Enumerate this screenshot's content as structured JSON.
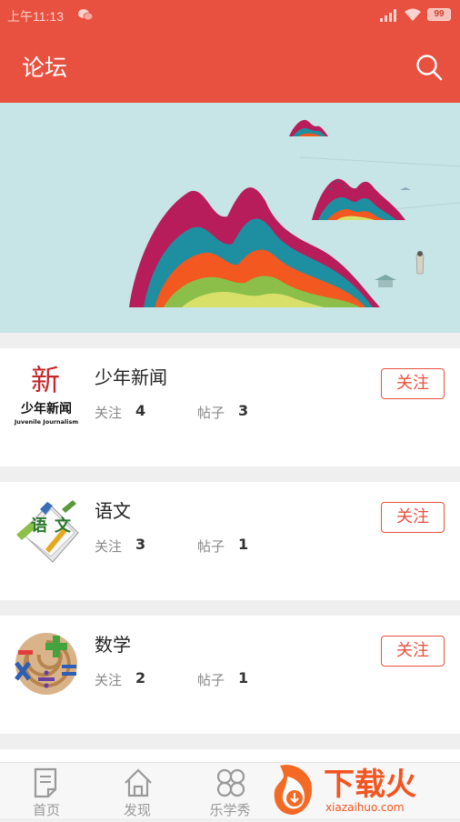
{
  "status_bar": {
    "time": "上午11:13",
    "battery": "99"
  },
  "header": {
    "title": "论坛"
  },
  "forums": [
    {
      "name": "少年新闻",
      "follow_label": "关注",
      "follow_count": "4",
      "posts_label": "帖子",
      "posts_count": "3",
      "follow_button": "关注",
      "logo_text": "少年新闻",
      "logo_subtext": "Juvenile Journalism",
      "logo_seal": "新"
    },
    {
      "name": "语文",
      "follow_label": "关注",
      "follow_count": "3",
      "posts_label": "帖子",
      "posts_count": "1",
      "follow_button": "关注",
      "logo_chars": [
        "语",
        "文"
      ]
    },
    {
      "name": "数学",
      "follow_label": "关注",
      "follow_count": "2",
      "posts_label": "帖子",
      "posts_count": "1",
      "follow_button": "关注"
    }
  ],
  "bottom_nav": [
    {
      "label": "首页",
      "icon": "document-icon"
    },
    {
      "label": "发现",
      "icon": "home-icon"
    },
    {
      "label": "乐学秀",
      "icon": "clover-icon"
    }
  ],
  "watermark": {
    "text": "下载火",
    "url": "xiazaihuo.com"
  },
  "colors": {
    "accent": "#e8503f",
    "background": "#efefef",
    "banner": "#c7e4e6"
  }
}
